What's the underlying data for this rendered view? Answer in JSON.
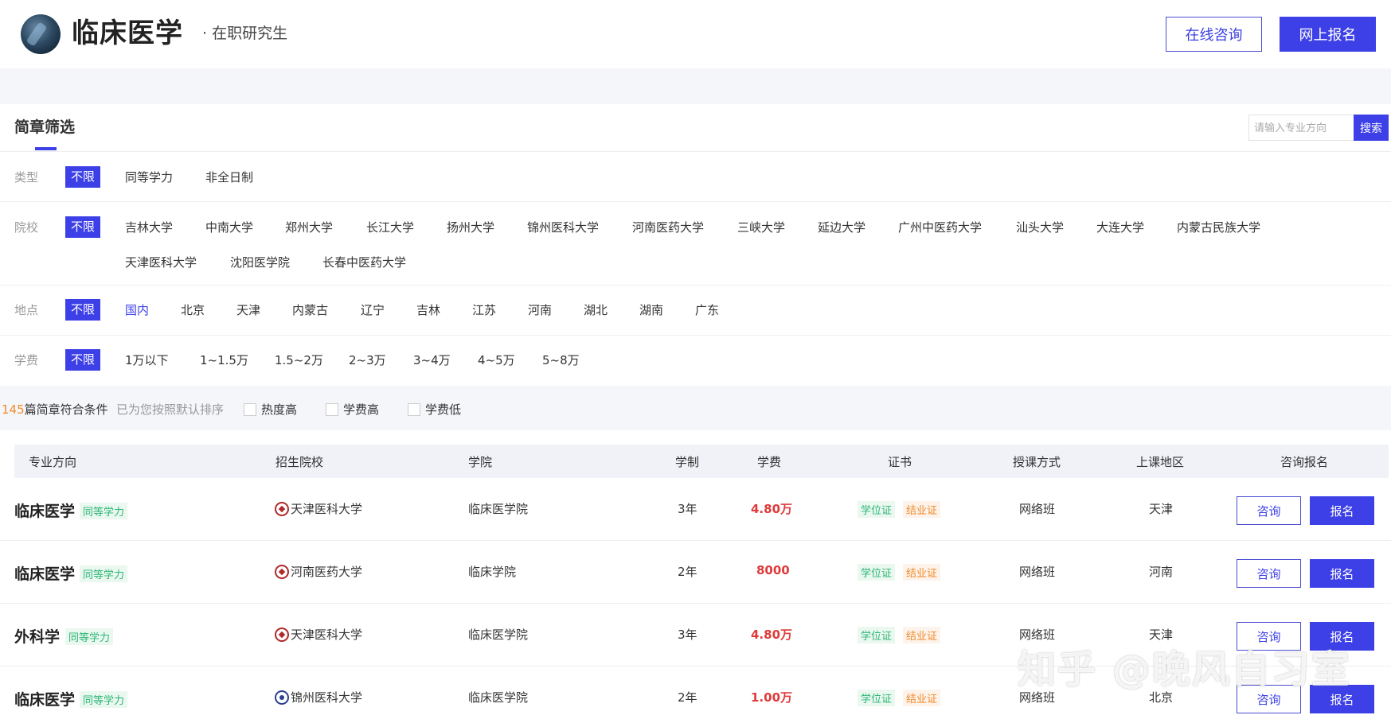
{
  "header": {
    "title": "临床医学",
    "subtitle": "· 在职研究生",
    "consult_label": "在线咨询",
    "apply_label": "网上报名"
  },
  "filter": {
    "title": "简章筛选",
    "search_placeholder": "请输入专业方向",
    "search_label": "搜索",
    "type": {
      "label": "类型",
      "options": [
        "不限",
        "同等学力",
        "非全日制"
      ]
    },
    "school": {
      "label": "院校",
      "options": [
        "不限",
        "吉林大学",
        "中南大学",
        "郑州大学",
        "长江大学",
        "扬州大学",
        "锦州医科大学",
        "河南医药大学",
        "三峡大学",
        "延边大学",
        "广州中医药大学",
        "汕头大学",
        "大连大学",
        "内蒙古民族大学",
        "天津医科大学",
        "沈阳医学院",
        "长春中医药大学"
      ]
    },
    "location": {
      "label": "地点",
      "options": [
        "不限",
        "国内",
        "北京",
        "天津",
        "内蒙古",
        "辽宁",
        "吉林",
        "江苏",
        "河南",
        "湖北",
        "湖南",
        "广东"
      ]
    },
    "fee": {
      "label": "学费",
      "options": [
        "不限",
        "1万以下",
        "1~1.5万",
        "1.5~2万",
        "2~3万",
        "3~4万",
        "4~5万",
        "5~8万"
      ]
    }
  },
  "results": {
    "count": "145",
    "count_suffix": "篇简章符合条件",
    "hint": "已为您按照默认排序",
    "sorts": [
      "热度高",
      "学费高",
      "学费低"
    ]
  },
  "table": {
    "headers": [
      "专业方向",
      "招生院校",
      "学院",
      "学制",
      "学费",
      "证书",
      "授课方式",
      "上课地区",
      "咨询报名"
    ],
    "rows": [
      {
        "major": "临床医学",
        "type": "同等学力",
        "school": "天津医科大学",
        "college": "临床医学院",
        "years": "3年",
        "fee": "4.80万",
        "cert1": "学位证",
        "cert2": "结业证",
        "mode": "网络班",
        "region": "天津",
        "consult": "咨询",
        "apply": "报名"
      },
      {
        "major": "临床医学",
        "type": "同等学力",
        "school": "河南医药大学",
        "college": "临床学院",
        "years": "2年",
        "fee": "8000",
        "cert1": "学位证",
        "cert2": "结业证",
        "mode": "网络班",
        "region": "河南",
        "consult": "咨询",
        "apply": "报名"
      },
      {
        "major": "外科学",
        "type": "同等学力",
        "school": "天津医科大学",
        "college": "临床医学院",
        "years": "3年",
        "fee": "4.80万",
        "cert1": "学位证",
        "cert2": "结业证",
        "mode": "网络班",
        "region": "天津",
        "consult": "咨询",
        "apply": "报名"
      },
      {
        "major": "临床医学",
        "type": "同等学力",
        "school": "锦州医科大学",
        "college": "临床医学院",
        "years": "2年",
        "fee": "1.00万",
        "cert1": "学位证",
        "cert2": "结业证",
        "mode": "网络班",
        "region": "北京",
        "consult": "咨询",
        "apply": "报名"
      }
    ]
  },
  "watermark": "知乎 @晚风自习室",
  "colors": {
    "accent": "#3d40e6",
    "fee": "#e03a3a",
    "count": "#f08a2a",
    "degree_tag": "#2bb673",
    "cert_tag": "#f08a2a"
  }
}
